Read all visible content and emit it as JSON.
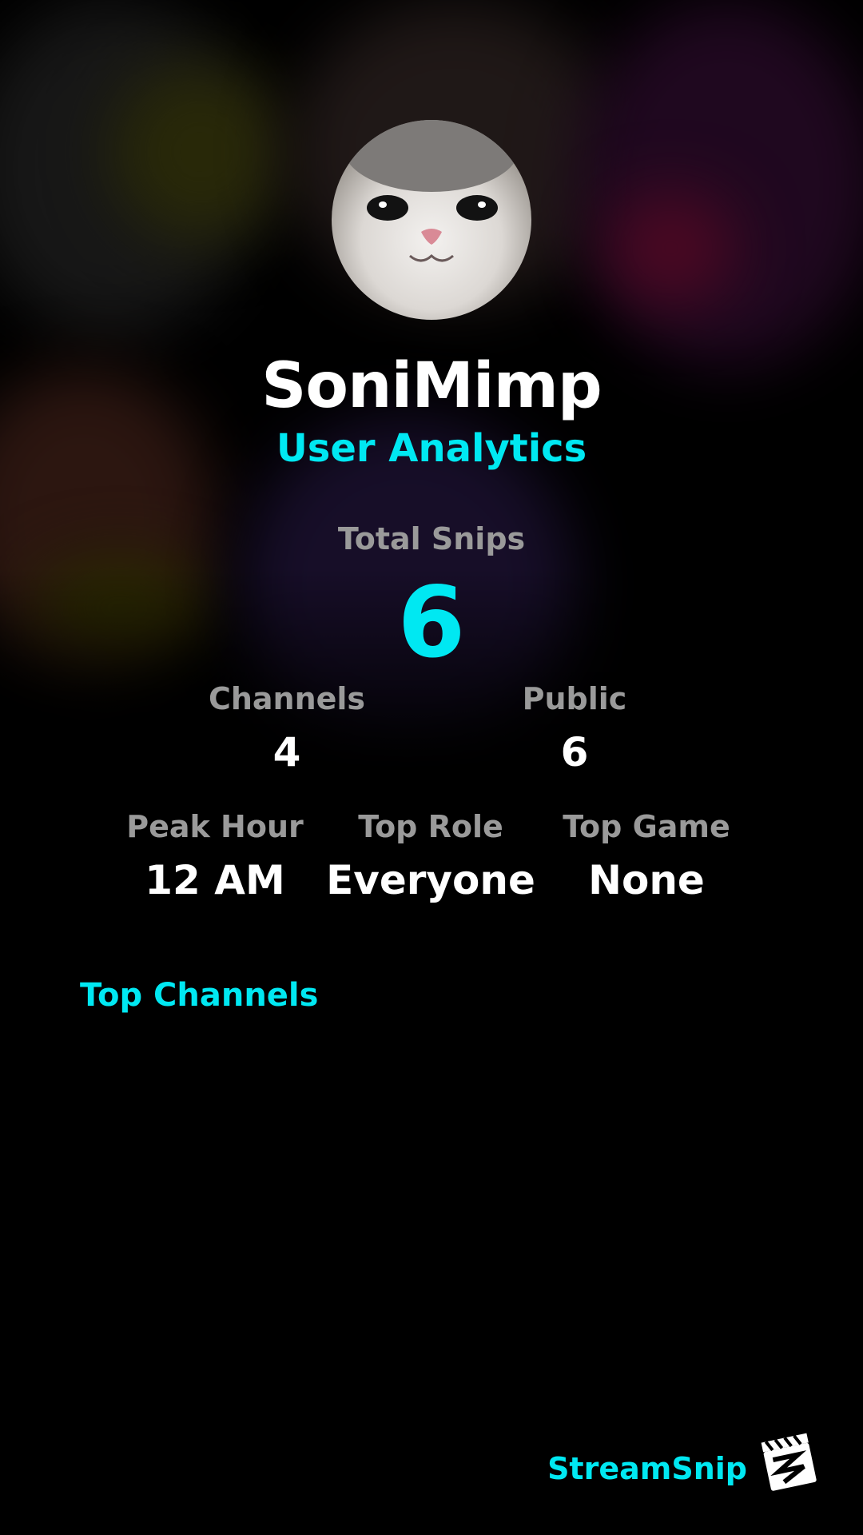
{
  "profile": {
    "username": "SoniMimp",
    "subtitle": "User Analytics"
  },
  "stats": {
    "total_snips_label": "Total Snips",
    "total_snips_value": "6",
    "channels_label": "Channels",
    "channels_value": "4",
    "public_label": "Public",
    "public_value": "6",
    "peak_hour_label": "Peak Hour",
    "peak_hour_value": "12 AM",
    "top_role_label": "Top Role",
    "top_role_value": "Everyone",
    "top_game_label": "Top Game",
    "top_game_value": "None"
  },
  "sections": {
    "top_channels_title": "Top Channels"
  },
  "footer": {
    "brand_name": "StreamSnip",
    "logo_icon": "clapperboard-icon"
  },
  "colors": {
    "accent": "#00e8f2",
    "background": "#000000",
    "label_gray": "#9a9a9a"
  }
}
